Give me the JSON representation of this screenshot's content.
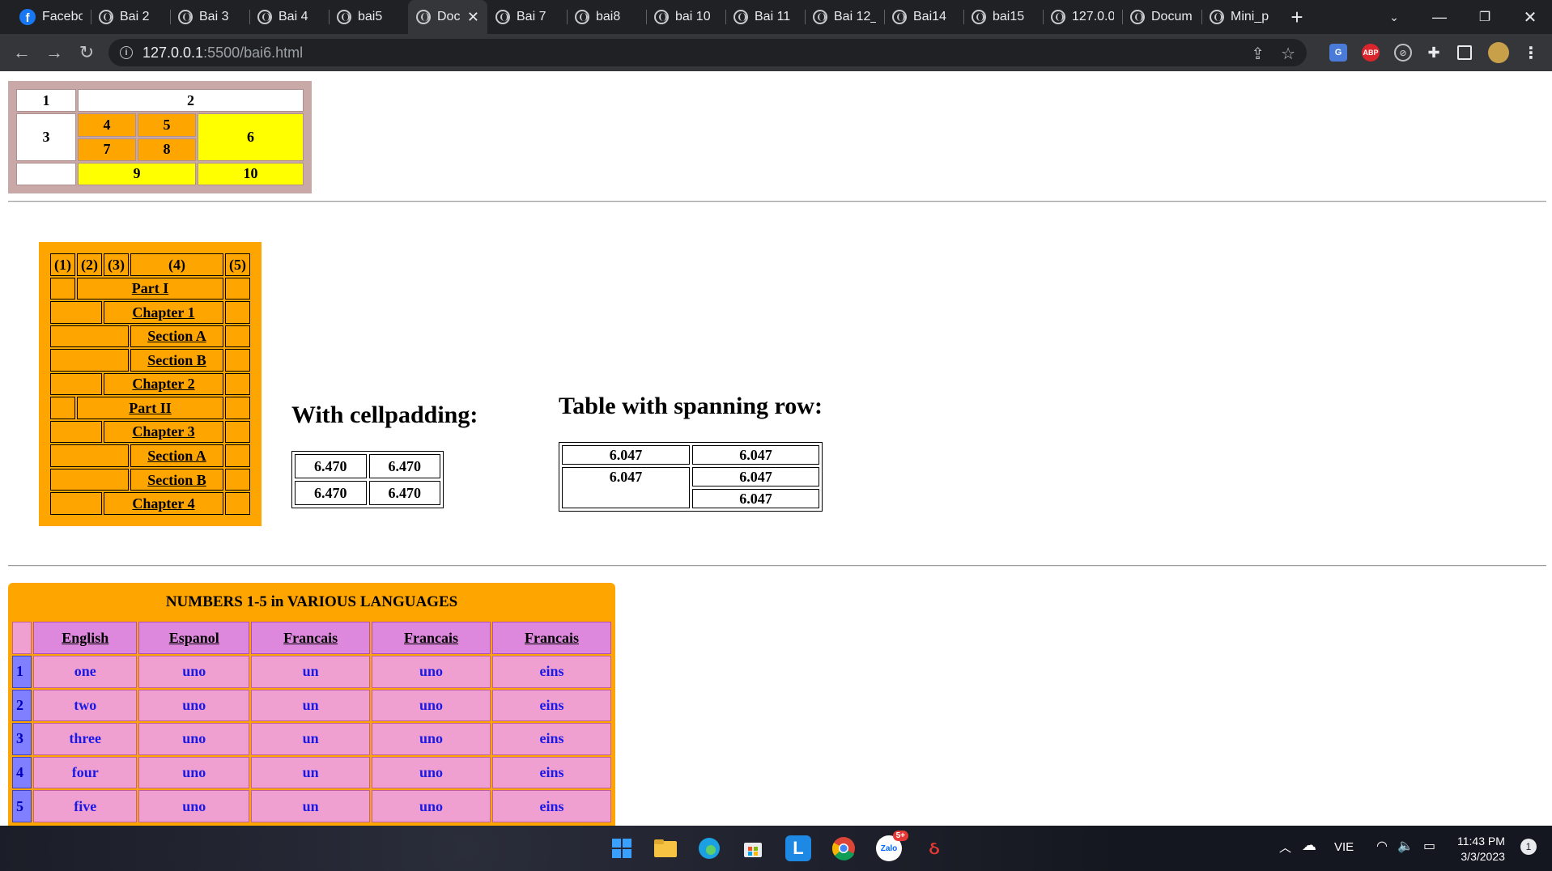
{
  "browser": {
    "tabs": [
      {
        "label": "Facebo",
        "icon": "facebook-icon",
        "active": false
      },
      {
        "label": "Bai 2",
        "icon": "globe-icon",
        "active": false
      },
      {
        "label": "Bai 3",
        "icon": "globe-icon",
        "active": false
      },
      {
        "label": "Bai 4",
        "icon": "globe-icon",
        "active": false
      },
      {
        "label": "bai5",
        "icon": "globe-icon",
        "active": false
      },
      {
        "label": "Doc",
        "icon": "globe-icon",
        "active": true
      },
      {
        "label": "Bai 7",
        "icon": "globe-icon",
        "active": false
      },
      {
        "label": "bai8",
        "icon": "globe-icon",
        "active": false
      },
      {
        "label": "bai 10",
        "icon": "globe-icon",
        "active": false
      },
      {
        "label": "Bai 11",
        "icon": "globe-icon",
        "active": false
      },
      {
        "label": "Bai 12_",
        "icon": "globe-icon",
        "active": false
      },
      {
        "label": "Bai14",
        "icon": "globe-icon",
        "active": false
      },
      {
        "label": "bai15",
        "icon": "globe-icon",
        "active": false
      },
      {
        "label": "127.0.0",
        "icon": "globe-icon",
        "active": false
      },
      {
        "label": "Docum",
        "icon": "globe-icon",
        "active": false
      },
      {
        "label": "Mini_p",
        "icon": "globe-icon",
        "active": false
      }
    ],
    "url_host": "127.0.0.1",
    "url_rest": ":5500/bai6.html",
    "ext_abp": "ABP"
  },
  "table1": {
    "c1": "1",
    "c2": "2",
    "c3": "3",
    "c4": "4",
    "c5": "5",
    "c6": "6",
    "c7": "7",
    "c8": "8",
    "c9": "9",
    "c10": "10",
    "colors": {
      "border_bg": "#c9a8a8",
      "orange": "#ffa500",
      "yellow": "#ffff00"
    }
  },
  "table2": {
    "headers": [
      "(1)",
      "(2)",
      "(3)",
      "(4)",
      "(5)"
    ],
    "rows": [
      "Part I",
      "Chapter 1",
      "Section A",
      "Section B",
      "Chapter 2",
      "Part II",
      "Chapter 3",
      "Section A",
      "Section B",
      "Chapter 4"
    ]
  },
  "cellpadding": {
    "heading": "With cellpadding:",
    "cells": [
      "6.470",
      "6.470",
      "6.470",
      "6.470"
    ]
  },
  "spanning": {
    "heading": "Table with spanning row:",
    "cells": [
      "6.047",
      "6.047",
      "6.047",
      "6.047",
      "6.047"
    ]
  },
  "languages": {
    "caption": "NUMBERS 1-5 in VARIOUS LANGUAGES",
    "headers": [
      "English",
      "Espanol",
      "Francais",
      "Francais",
      "Francais"
    ],
    "rows": [
      {
        "n": "1",
        "cells": [
          "one",
          "uno",
          "un",
          "uno",
          "eins"
        ]
      },
      {
        "n": "2",
        "cells": [
          "two",
          "uno",
          "un",
          "uno",
          "eins"
        ]
      },
      {
        "n": "3",
        "cells": [
          "three",
          "uno",
          "un",
          "uno",
          "eins"
        ]
      },
      {
        "n": "4",
        "cells": [
          "four",
          "uno",
          "un",
          "uno",
          "eins"
        ]
      },
      {
        "n": "5",
        "cells": [
          "five",
          "uno",
          "un",
          "uno",
          "eins"
        ]
      }
    ],
    "colors": {
      "header": "#dd88dd",
      "cell": "#f0a0d0",
      "number": "#7f7fff",
      "text": "#1a1ae6"
    }
  },
  "taskbar": {
    "zalo_label": "Zalo",
    "zalo_badge": "5+",
    "lang": "VIE",
    "time": "11:43 PM",
    "date": "3/3/2023",
    "notif_count": "1"
  }
}
